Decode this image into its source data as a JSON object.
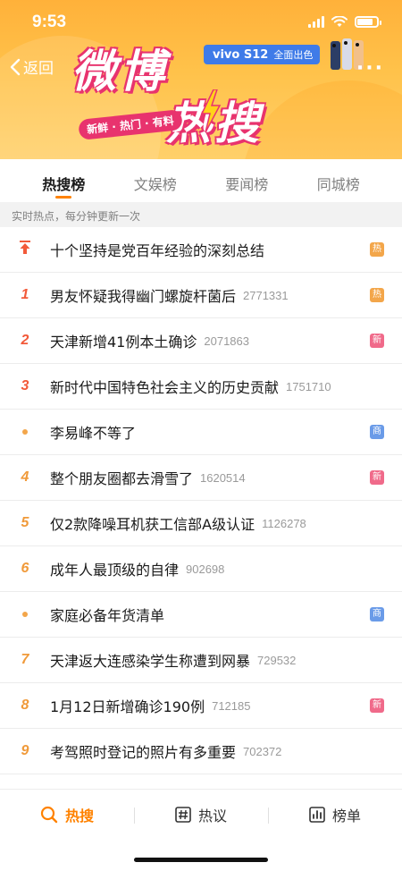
{
  "status_bar": {
    "time": "9:53"
  },
  "header": {
    "back_label": "返回",
    "more_label": "···",
    "logo_line1": "微博",
    "logo_line2": "热搜",
    "slogan": "新鲜 · 热门 · 有料",
    "ad": {
      "brand": "vivo S12",
      "text": "全面出色"
    },
    "accent_color": "#e8336e"
  },
  "tabs": [
    {
      "label": "热搜榜",
      "active": true
    },
    {
      "label": "文娱榜",
      "active": false
    },
    {
      "label": "要闻榜",
      "active": false
    },
    {
      "label": "同城榜",
      "active": false
    }
  ],
  "subheader": "实时热点，每分钟更新一次",
  "list": [
    {
      "rank": "",
      "rank_type": "pin",
      "title": "十个坚持是党百年经验的深刻总结",
      "count": "",
      "badge": "热",
      "badge_color": "#f3a64a"
    },
    {
      "rank": "1",
      "rank_type": "top",
      "title": "男友怀疑我得幽门螺旋杆菌后",
      "count": "2771331",
      "badge": "热",
      "badge_color": "#f3a64a"
    },
    {
      "rank": "2",
      "rank_type": "top",
      "title": "天津新增41例本土确诊",
      "count": "2071863",
      "badge": "新",
      "badge_color": "#f06a8a"
    },
    {
      "rank": "3",
      "rank_type": "top",
      "title": "新时代中国特色社会主义的历史贡献",
      "count": "1751710",
      "badge": "",
      "badge_color": ""
    },
    {
      "rank": "",
      "rank_type": "dot",
      "title": "李易峰不等了",
      "count": "",
      "badge": "商",
      "badge_color": "#6a9be8"
    },
    {
      "rank": "4",
      "rank_type": "mid",
      "title": "整个朋友圈都去滑雪了",
      "count": "1620514",
      "badge": "新",
      "badge_color": "#f06a8a"
    },
    {
      "rank": "5",
      "rank_type": "mid",
      "title": "仅2款降噪耳机获工信部A级认证",
      "count": "1126278",
      "badge": "",
      "badge_color": ""
    },
    {
      "rank": "6",
      "rank_type": "mid",
      "title": "成年人最顶级的自律",
      "count": "902698",
      "badge": "",
      "badge_color": ""
    },
    {
      "rank": "",
      "rank_type": "dot",
      "title": "家庭必备年货清单",
      "count": "",
      "badge": "商",
      "badge_color": "#6a9be8"
    },
    {
      "rank": "7",
      "rank_type": "mid",
      "title": "天津返大连感染学生称遭到网暴",
      "count": "729532",
      "badge": "",
      "badge_color": ""
    },
    {
      "rank": "8",
      "rank_type": "mid",
      "title": "1月12日新增确诊190例",
      "count": "712185",
      "badge": "新",
      "badge_color": "#f06a8a"
    },
    {
      "rank": "9",
      "rank_type": "mid",
      "title": "考驾照时登记的照片有多重要",
      "count": "702372",
      "badge": "",
      "badge_color": ""
    }
  ],
  "bottom_nav": [
    {
      "label": "热搜",
      "icon": "search-icon",
      "active": true
    },
    {
      "label": "热议",
      "icon": "hash-icon",
      "active": false
    },
    {
      "label": "榜单",
      "icon": "chart-icon",
      "active": false
    }
  ]
}
